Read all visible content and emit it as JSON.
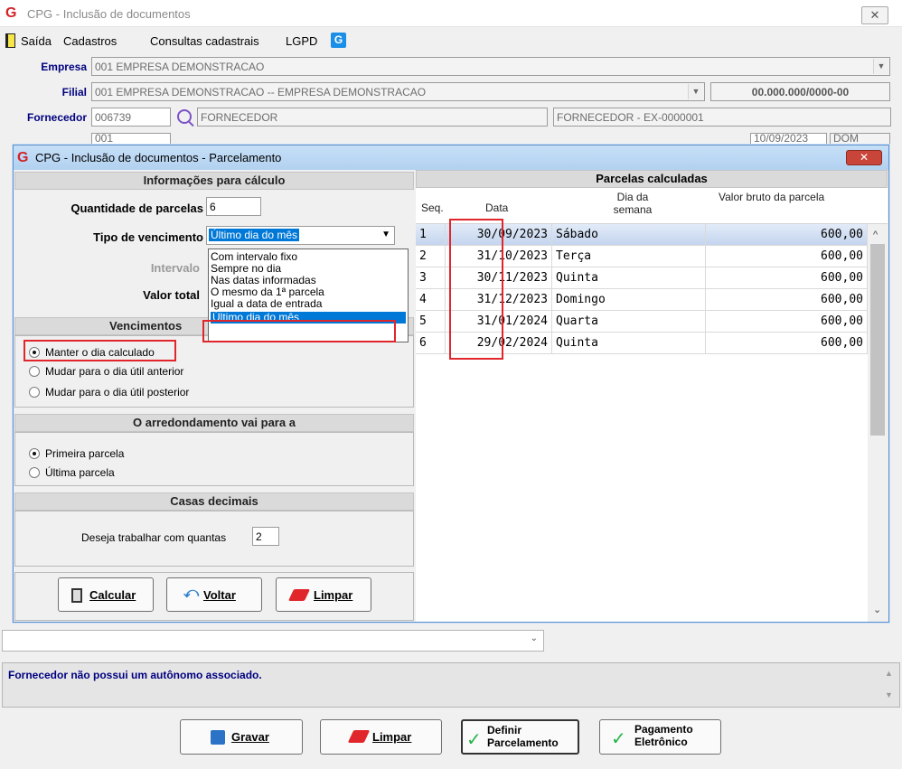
{
  "window": {
    "title": "CPG - Inclusão de documentos",
    "close": "✕"
  },
  "menu": {
    "items": [
      "Saída",
      "Cadastros",
      "Consultas cadastrais",
      "LGPD"
    ]
  },
  "form": {
    "empresa_label": "Empresa",
    "empresa_value": "001 EMPRESA DEMONSTRACAO",
    "filial_label": "Filial",
    "filial_value": "001 EMPRESA DEMONSTRACAO -- EMPRESA DEMONSTRACAO",
    "cnpj": "00.000.000/0000-00",
    "fornecedor_label": "Fornecedor",
    "fornecedor_code": "006739",
    "fornecedor_name": "FORNECEDOR",
    "fornecedor_desc": "FORNECEDOR - EX-0000001",
    "serie_value": "001",
    "emissao_date": "10/09/2023",
    "dow": "DOM"
  },
  "dialog": {
    "title": "CPG - Inclusão de documentos - Parcelamento",
    "close": "✕",
    "info_header": "Informações para cálculo",
    "qtd_label": "Quantidade de parcelas",
    "qtd_value": "6",
    "tipo_label": "Tipo de vencimento",
    "tipo_value": "Último dia do mês",
    "intervalo_label": "Intervalo",
    "valor_total_label": "Valor total",
    "dropdown_options": [
      "Com intervalo fixo",
      "Sempre no dia",
      "Nas datas informadas",
      "O mesmo da 1ª parcela",
      "Igual a data de entrada",
      "Último dia do mês"
    ],
    "venc_header": "Vencimentos",
    "venc_options": [
      "Manter o dia calculado",
      "Mudar para o dia útil anterior",
      "Mudar para o dia útil posterior"
    ],
    "arred_header": "O arredondamento vai para a",
    "arred_options": [
      "Primeira parcela",
      "Última parcela"
    ],
    "casas_header": "Casas decimais",
    "casas_label": "Deseja trabalhar com quantas",
    "casas_value": "2",
    "btn_calcular": "Calcular",
    "btn_voltar": "Voltar",
    "btn_limpar": "Limpar"
  },
  "table": {
    "header": "Parcelas calculadas",
    "col_seq": "Seq.",
    "col_data": "Data",
    "col_dia_1": "Dia da",
    "col_dia_2": "semana",
    "col_valor": "Valor bruto da parcela",
    "rows": [
      {
        "seq": "1",
        "data": "30/09/2023",
        "dia": "Sábado",
        "valor": "600,00"
      },
      {
        "seq": "2",
        "data": "31/10/2023",
        "dia": "Terça",
        "valor": "600,00"
      },
      {
        "seq": "3",
        "data": "30/11/2023",
        "dia": "Quinta",
        "valor": "600,00"
      },
      {
        "seq": "4",
        "data": "31/12/2023",
        "dia": "Domingo",
        "valor": "600,00"
      },
      {
        "seq": "5",
        "data": "31/01/2024",
        "dia": "Quarta",
        "valor": "600,00"
      },
      {
        "seq": "6",
        "data": "29/02/2024",
        "dia": "Quinta",
        "valor": "600,00"
      }
    ]
  },
  "status": {
    "message": "Fornecedor não possui um autônomo associado."
  },
  "footer": {
    "gravar": "Gravar",
    "limpar": "Limpar",
    "definir_1": "Definir",
    "definir_2": "Parcelamento",
    "pagamento_1": "Pagamento",
    "pagamento_2": "Eletrônico"
  },
  "colors": {
    "accent_red": "#e0262b",
    "label_blue": "#000080",
    "selection_blue": "#0078d7"
  }
}
